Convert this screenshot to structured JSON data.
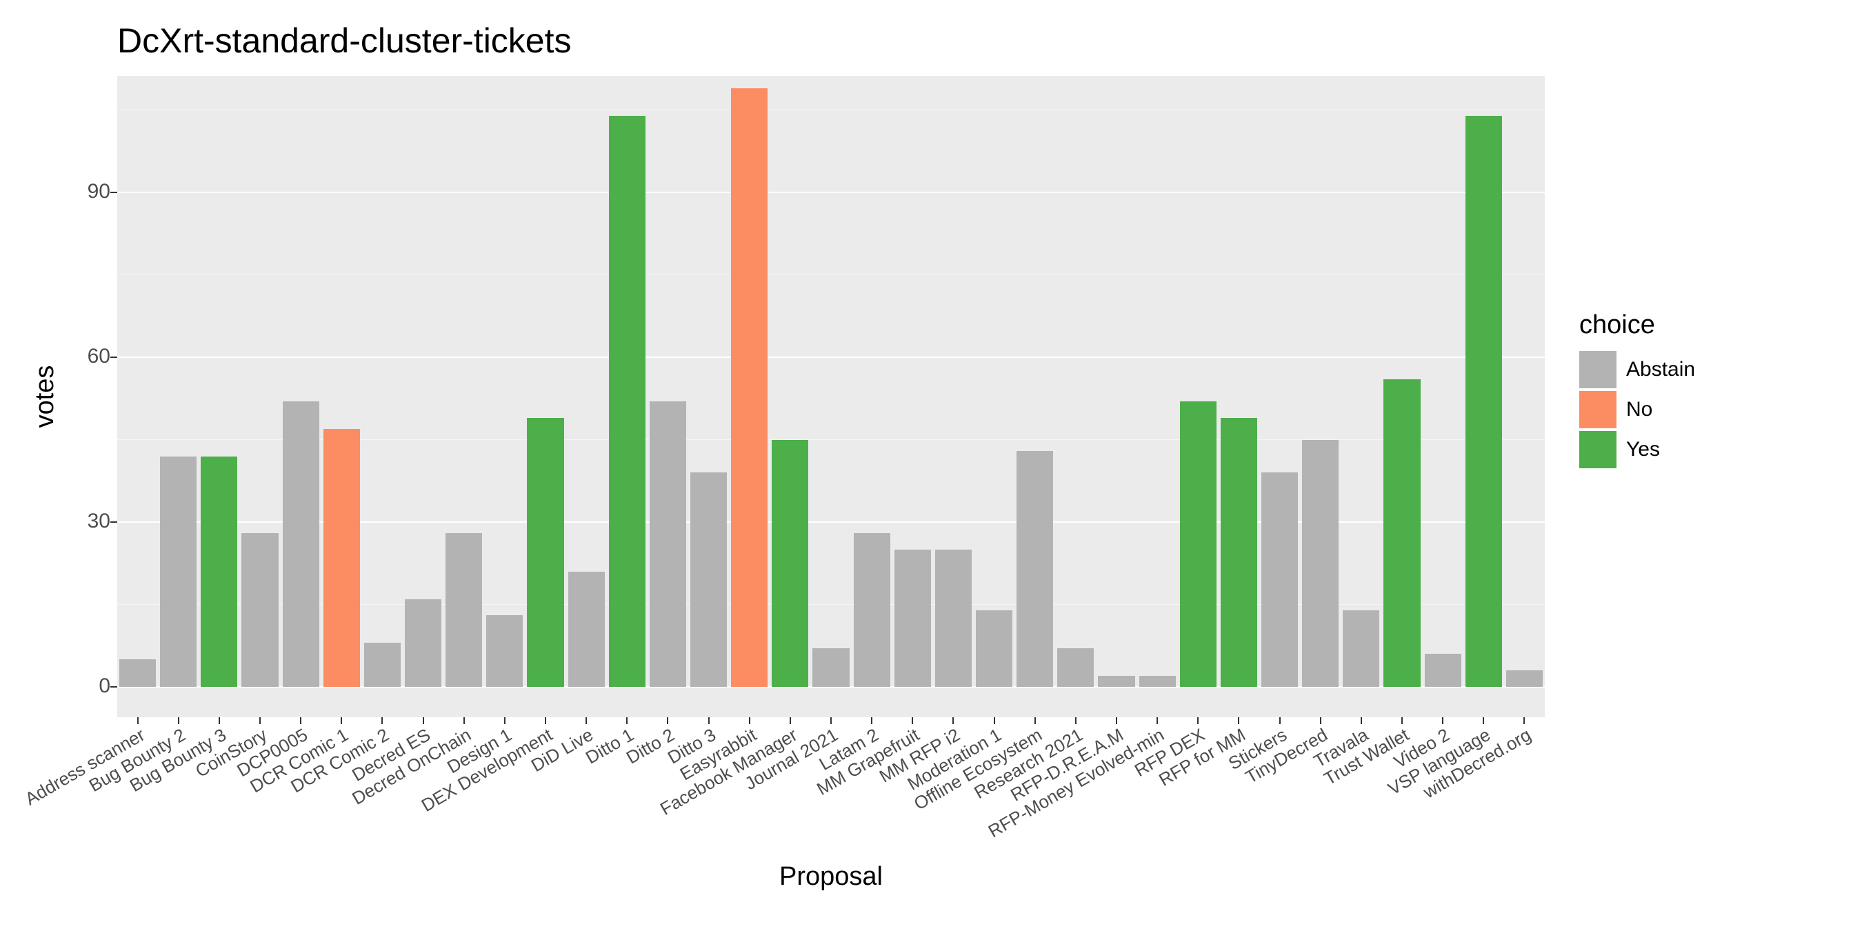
{
  "chart_data": {
    "type": "bar",
    "title": "DcXrt-standard-cluster-tickets",
    "xlabel": "Proposal",
    "ylabel": "votes",
    "ylim": [
      0,
      110
    ],
    "y_ticks": [
      0,
      30,
      60,
      90
    ],
    "legend_title": "choice",
    "series_meta": [
      {
        "key": "Abstain",
        "label": "Abstain",
        "color": "#b3b3b3"
      },
      {
        "key": "No",
        "label": "No",
        "color": "#fc8d62"
      },
      {
        "key": "Yes",
        "label": "Yes",
        "color": "#4daf4a"
      }
    ],
    "categories": [
      "Address scanner",
      "Bug Bounty 2",
      "Bug Bounty 3",
      "CoinStory",
      "DCP0005",
      "DCR Comic 1",
      "DCR Comic 2",
      "Decred ES",
      "Decred OnChain",
      "Design 1",
      "DEX Development",
      "DiD Live",
      "Ditto 1",
      "Ditto 2",
      "Ditto 3",
      "Easyrabbit",
      "Facebook Manager",
      "Journal 2021",
      "Latam 2",
      "MM Grapefruit",
      "MM RFP i2",
      "Moderation 1",
      "Offline Ecosystem",
      "Research 2021",
      "RFP-D.R.E.A.M",
      "RFP-Money Evolved-min",
      "RFP DEX",
      "RFP for MM",
      "Stickers",
      "TinyDecred",
      "Travala",
      "Trust Wallet",
      "Video 2",
      "VSP language",
      "withDecred.org"
    ],
    "data": [
      {
        "choice": "Abstain",
        "value": 5
      },
      {
        "choice": "Abstain",
        "value": 42
      },
      {
        "choice": "Yes",
        "value": 42
      },
      {
        "choice": "Abstain",
        "value": 28
      },
      {
        "choice": "Abstain",
        "value": 52
      },
      {
        "choice": "No",
        "value": 47
      },
      {
        "choice": "Abstain",
        "value": 8
      },
      {
        "choice": "Abstain",
        "value": 16
      },
      {
        "choice": "Abstain",
        "value": 28
      },
      {
        "choice": "Abstain",
        "value": 13
      },
      {
        "choice": "Yes",
        "value": 49
      },
      {
        "choice": "Abstain",
        "value": 21
      },
      {
        "choice": "Yes",
        "value": 104
      },
      {
        "choice": "Abstain",
        "value": 52
      },
      {
        "choice": "Abstain",
        "value": 39
      },
      {
        "choice": "No",
        "value": 109
      },
      {
        "choice": "Yes",
        "value": 45
      },
      {
        "choice": "Abstain",
        "value": 7
      },
      {
        "choice": "Abstain",
        "value": 28
      },
      {
        "choice": "Abstain",
        "value": 25
      },
      {
        "choice": "Abstain",
        "value": 25
      },
      {
        "choice": "Abstain",
        "value": 14
      },
      {
        "choice": "Abstain",
        "value": 43
      },
      {
        "choice": "Abstain",
        "value": 7
      },
      {
        "choice": "Abstain",
        "value": 2
      },
      {
        "choice": "Abstain",
        "value": 2
      },
      {
        "choice": "Yes",
        "value": 52
      },
      {
        "choice": "Yes",
        "value": 49
      },
      {
        "choice": "Abstain",
        "value": 39
      },
      {
        "choice": "Abstain",
        "value": 45
      },
      {
        "choice": "Abstain",
        "value": 14
      },
      {
        "choice": "Yes",
        "value": 56
      },
      {
        "choice": "Abstain",
        "value": 6
      },
      {
        "choice": "Yes",
        "value": 104
      },
      {
        "choice": "Abstain",
        "value": 3
      }
    ]
  }
}
